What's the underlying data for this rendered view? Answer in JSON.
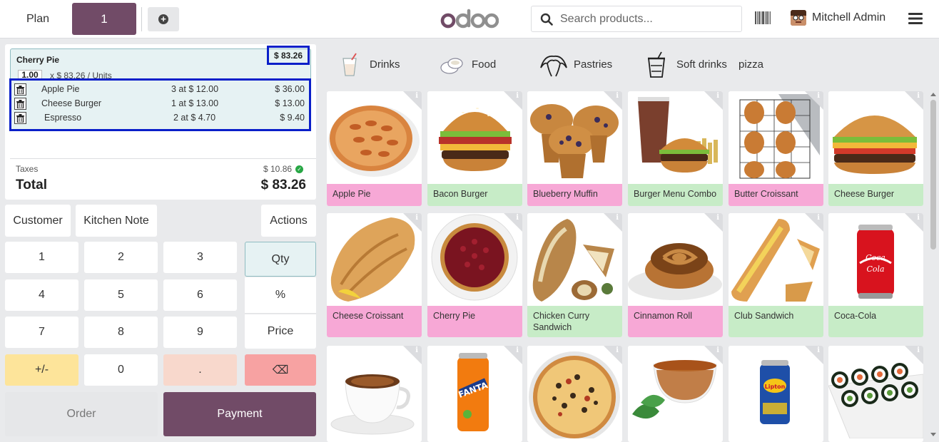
{
  "topbar": {
    "plan_label": "Plan",
    "order_tab": "1",
    "logo_text": "odoo",
    "search_placeholder": "Search products...",
    "user_name": "Mitchell Admin"
  },
  "order": {
    "line": {
      "name": "Cherry Pie",
      "price": "$ 83.26",
      "qty": "1.00",
      "unit_text": "x $ 83.26 / Units"
    },
    "combo_items": [
      {
        "name": "Apple Pie",
        "qty": "3 at $ 12.00",
        "total": "$ 36.00"
      },
      {
        "name": "Cheese Burger",
        "qty": "1 at $ 13.00",
        "total": "$ 13.00"
      },
      {
        "name": "Espresso",
        "qty": "2 at $ 4.70",
        "total": "$ 9.40"
      }
    ],
    "taxes_label": "Taxes",
    "taxes_value": "$ 10.86",
    "total_label": "Total",
    "total_value": "$ 83.26"
  },
  "controls": {
    "customer": "Customer",
    "kitchen_note": "Kitchen Note",
    "actions": "Actions"
  },
  "numpad": {
    "keys": [
      "1",
      "2",
      "3",
      "4",
      "5",
      "6",
      "7",
      "8",
      "9",
      "+/-",
      "0",
      "."
    ],
    "modes": [
      "Qty",
      "%",
      "Price"
    ],
    "backspace": "⌫"
  },
  "footer": {
    "order": "Order",
    "payment": "Payment"
  },
  "categories": [
    {
      "label": "Drinks",
      "color": "#f8d8cc"
    },
    {
      "label": "Food",
      "color": "#c7ecc7"
    },
    {
      "label": "Pastries",
      "color": "#f7a8d6"
    },
    {
      "label": "Soft drinks",
      "color": "#c7ecc7"
    },
    {
      "label": "pizza",
      "color": "#f7a2a2"
    }
  ],
  "products": [
    {
      "name": "Apple Pie",
      "color": "#f7a8d6"
    },
    {
      "name": "Bacon Burger",
      "color": "#c7ecc7"
    },
    {
      "name": "Blueberry Muffin",
      "color": "#f7a8d6"
    },
    {
      "name": "Burger Menu Combo",
      "color": "#c7ecc7"
    },
    {
      "name": "Butter Croissant",
      "color": "#f7a8d6"
    },
    {
      "name": "Cheese Burger",
      "color": "#c7ecc7"
    },
    {
      "name": "Cheese Croissant",
      "color": "#f7a8d6"
    },
    {
      "name": "Cherry Pie",
      "color": "#f7a8d6"
    },
    {
      "name": "Chicken Curry Sandwich",
      "color": "#c7ecc7"
    },
    {
      "name": "Cinnamon Roll",
      "color": "#f7a8d6"
    },
    {
      "name": "Club Sandwich",
      "color": "#c7ecc7"
    },
    {
      "name": "Coca-Cola",
      "color": "#c7ecc7"
    }
  ],
  "colors": {
    "brand": "#714b67",
    "highlight_border": "#0a1fc9",
    "selected_line_bg": "#e6f2f3"
  }
}
